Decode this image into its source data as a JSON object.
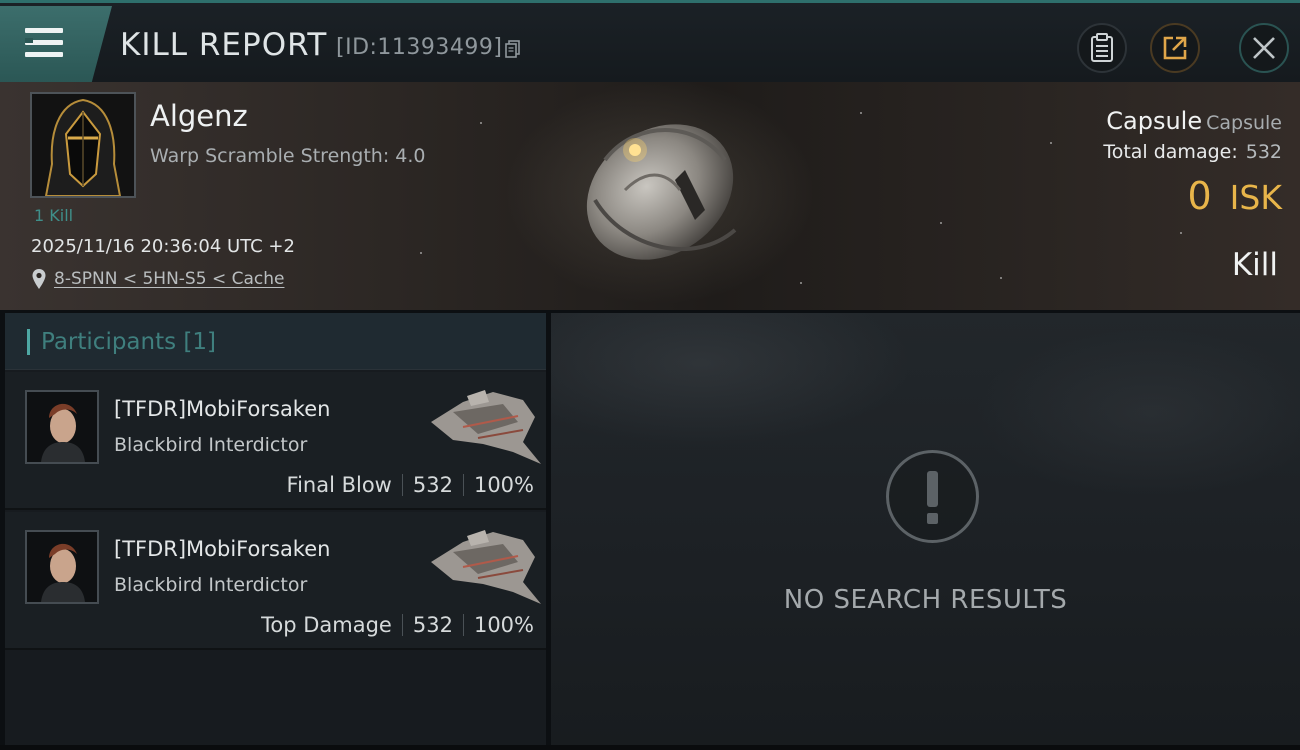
{
  "header": {
    "title": "KILL REPORT",
    "report_id": "[ID:11393499]"
  },
  "victim": {
    "name": "Algenz",
    "stat": "Warp Scramble Strength: 4.0",
    "kill_count": "1 Kill",
    "timestamp": "2025/11/16 20:36:04 UTC +2",
    "location": "8-SPNN < 5HN-S5 < Cache",
    "ship_name": "Capsule",
    "ship_type": "Capsule",
    "total_damage_label": "Total damage:",
    "total_damage": "532",
    "isk_value": "0",
    "isk_label": "ISK",
    "result": "Kill"
  },
  "participants": {
    "header": "Participants [1]",
    "rows": [
      {
        "name": "[TFDR]MobiForsaken",
        "ship": "Blackbird Interdictor",
        "role": "Final Blow",
        "damage": "532",
        "percent": "100%"
      },
      {
        "name": "[TFDR]MobiForsaken",
        "ship": "Blackbird Interdictor",
        "role": "Top Damage",
        "damage": "532",
        "percent": "100%"
      }
    ]
  },
  "results": {
    "empty_message": "NO SEARCH RESULTS"
  },
  "icons": {
    "menu": "menu-icon",
    "copy": "copy-icon",
    "clipboard": "clipboard-icon",
    "share": "share-icon",
    "close": "close-icon",
    "location": "location-pin-icon",
    "alert": "alert-icon"
  },
  "colors": {
    "accent_teal": "#3c6e6c",
    "isk_gold": "#e8b54a",
    "kill_count_teal": "#3f8f8a"
  }
}
